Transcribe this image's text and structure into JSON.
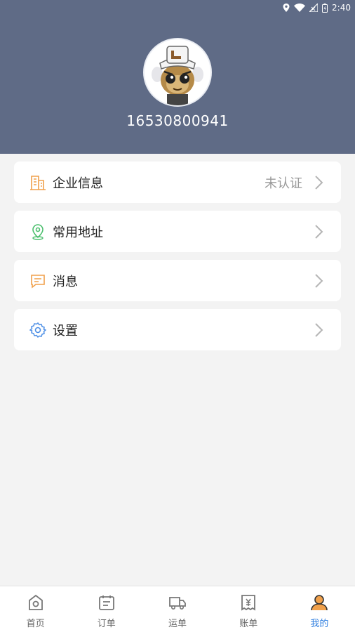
{
  "status_bar": {
    "time": "2:40"
  },
  "profile": {
    "phone": "16530800941"
  },
  "menu": [
    {
      "label": "企业信息",
      "value": "未认证",
      "icon": "building-icon"
    },
    {
      "label": "常用地址",
      "value": "",
      "icon": "location-pin-icon"
    },
    {
      "label": "消息",
      "value": "",
      "icon": "message-icon"
    },
    {
      "label": "设置",
      "value": "",
      "icon": "gear-icon"
    }
  ],
  "tabs": [
    {
      "label": "首页",
      "icon": "home-icon"
    },
    {
      "label": "订单",
      "icon": "order-icon"
    },
    {
      "label": "运单",
      "icon": "truck-icon"
    },
    {
      "label": "账单",
      "icon": "bill-icon"
    },
    {
      "label": "我的",
      "icon": "profile-icon",
      "active": true
    }
  ],
  "colors": {
    "header_bg": "#5f6b86",
    "active_tab": "#2f7fe0",
    "accent_orange": "#f0a04b",
    "accent_green": "#4cbf6e",
    "accent_blue": "#4d8fe6"
  }
}
